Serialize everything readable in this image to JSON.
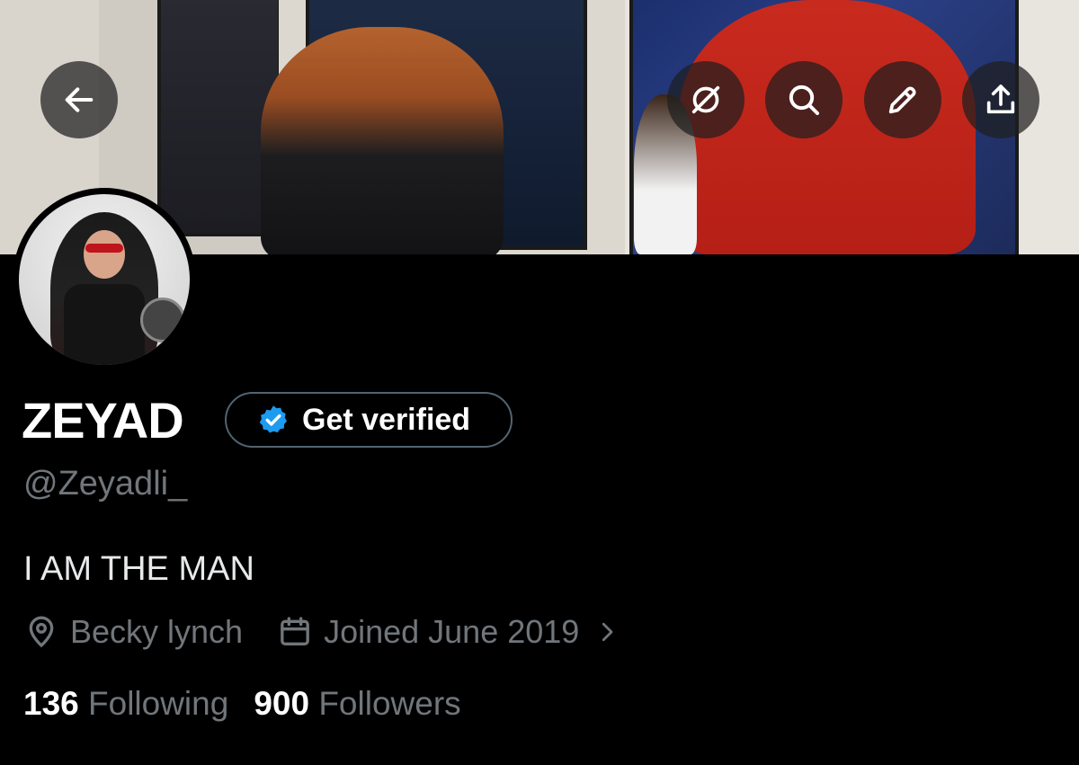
{
  "header": {
    "back_icon": "arrow-left-icon",
    "buttons": [
      "grok-icon",
      "search-icon",
      "edit-icon",
      "share-icon"
    ]
  },
  "profile": {
    "name": "ZEYAD",
    "get_verified_label": "Get verified",
    "handle": "@Zeyadli_",
    "bio": "I AM THE MAN",
    "location": "Becky lynch",
    "joined": "Joined June 2019",
    "following_count": "136",
    "following_label": "Following",
    "followers_count": "900",
    "followers_label": "Followers"
  },
  "colors": {
    "background": "#000000",
    "verified_badge": "#1d9bf0",
    "muted_text": "#71767b"
  }
}
